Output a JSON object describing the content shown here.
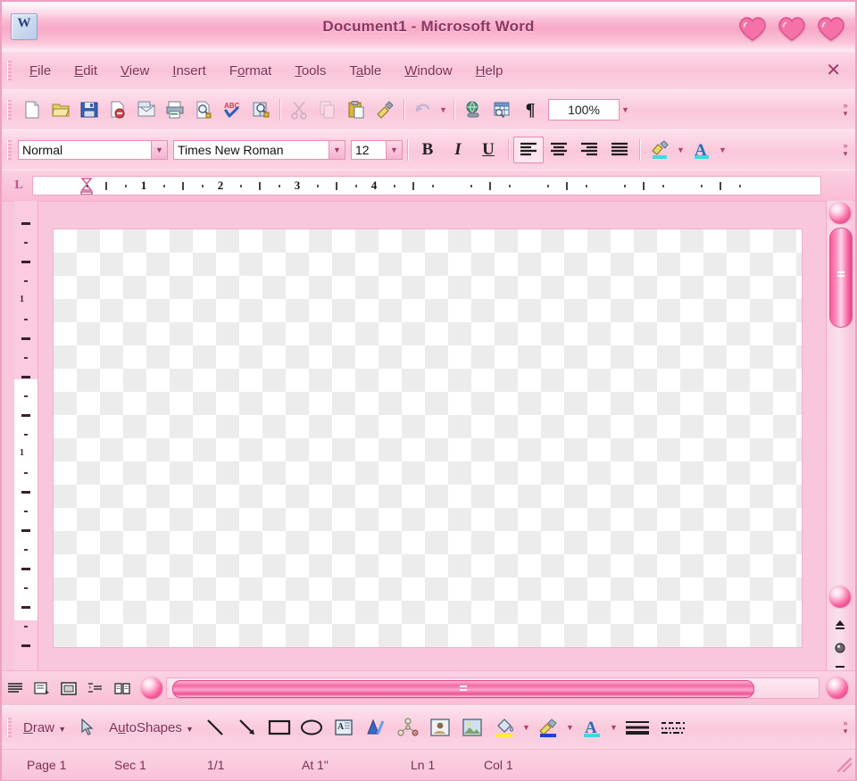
{
  "window": {
    "title": "Document1 - Microsoft Word",
    "app_icon": "word-document-icon",
    "controls": [
      {
        "name": "minimize-button",
        "icon": "heart-icon",
        "label": "Minimize"
      },
      {
        "name": "maximize-button",
        "icon": "heart-icon",
        "label": "Maximize"
      },
      {
        "name": "close-button",
        "icon": "heart-icon",
        "label": "Close"
      }
    ],
    "theme_colors": {
      "accent": "#f569a4",
      "title_text": "#8c3560",
      "chrome_light": "#fde1ec",
      "chrome_mid": "#fac7db",
      "chrome_dark": "#f09ec0",
      "heart": "#f472a8"
    }
  },
  "menubar": {
    "items": [
      {
        "label": "File",
        "accel": "F"
      },
      {
        "label": "Edit",
        "accel": "E"
      },
      {
        "label": "View",
        "accel": "V"
      },
      {
        "label": "Insert",
        "accel": "I"
      },
      {
        "label": "Format",
        "accel": "o"
      },
      {
        "label": "Tools",
        "accel": "T"
      },
      {
        "label": "Table",
        "accel": "a"
      },
      {
        "label": "Window",
        "accel": "W"
      },
      {
        "label": "Help",
        "accel": "H"
      }
    ],
    "close_document_label": "✕"
  },
  "standard_toolbar": {
    "buttons": [
      {
        "name": "new-document-button",
        "icon": "new-page-icon",
        "enabled": true
      },
      {
        "name": "open-button",
        "icon": "open-folder-icon",
        "enabled": true
      },
      {
        "name": "save-button",
        "icon": "floppy-disk-icon",
        "enabled": true
      },
      {
        "name": "permission-button",
        "icon": "document-lock-icon",
        "enabled": true
      },
      {
        "name": "email-button",
        "icon": "envelope-mail-icon",
        "enabled": true
      },
      {
        "name": "print-button",
        "icon": "printer-icon",
        "enabled": true
      },
      {
        "name": "print-preview-button",
        "icon": "magnifier-page-icon",
        "enabled": true
      },
      {
        "name": "spelling-grammar-button",
        "icon": "abc-check-icon",
        "enabled": true
      },
      {
        "name": "research-button",
        "icon": "book-magnifier-icon",
        "enabled": true
      },
      {
        "name": "cut-button",
        "icon": "scissors-icon",
        "enabled": false
      },
      {
        "name": "copy-button",
        "icon": "copy-pages-icon",
        "enabled": false
      },
      {
        "name": "paste-button",
        "icon": "clipboard-paste-icon",
        "enabled": true
      },
      {
        "name": "format-painter-button",
        "icon": "paintbrush-icon",
        "enabled": true
      },
      {
        "name": "undo-button",
        "icon": "undo-arrow-icon",
        "enabled": false
      },
      {
        "name": "insert-hyperlink-button",
        "icon": "globe-link-icon",
        "enabled": true
      },
      {
        "name": "tables-and-borders-button",
        "icon": "table-borders-icon",
        "enabled": true
      },
      {
        "name": "show-formatting-button",
        "icon": "pilcrow-icon",
        "enabled": true,
        "glyph": "¶"
      }
    ],
    "zoom": {
      "value": "100%",
      "dropdown_icon": "chevron-down-icon"
    },
    "overflow_icon": "toolbar-options-icon"
  },
  "formatting_toolbar": {
    "style": {
      "label": "Style",
      "value": "Normal",
      "dropdown_icon": "chevron-down-icon"
    },
    "font": {
      "label": "Font",
      "value": "Times New Roman",
      "dropdown_icon": "chevron-down-icon"
    },
    "size": {
      "label": "Font Size",
      "value": "12",
      "dropdown_icon": "chevron-down-icon"
    },
    "bold": {
      "glyph": "B",
      "active": false
    },
    "italic": {
      "glyph": "I",
      "active": false
    },
    "underline": {
      "glyph": "U",
      "active": false
    },
    "align": [
      {
        "name": "align-left-button",
        "active": true
      },
      {
        "name": "align-center-button",
        "active": false
      },
      {
        "name": "align-right-button",
        "active": false
      },
      {
        "name": "align-justify-button",
        "active": false
      }
    ],
    "highlight": {
      "name": "highlight-color-button",
      "swatch": "#3fd8e0"
    },
    "font_color": {
      "name": "font-color-button",
      "glyph": "A",
      "swatch": "#3fd8e0"
    },
    "overflow_icon": "toolbar-options-icon"
  },
  "ruler": {
    "tab_stop_selector": {
      "name": "tab-stop-selector",
      "glyph": "L"
    },
    "horizontal_numbers": [
      "1",
      "2",
      "3",
      "4"
    ],
    "vertical_numbers": [
      "1",
      "1"
    ],
    "indent_marker_icon": "hourglass-indent-icon"
  },
  "document": {
    "page_background": "transparency-checkerboard",
    "content": ""
  },
  "scrollbars": {
    "vertical": {
      "up_button_icon": "pearl-up-icon",
      "down_button_icon": "pearl-down-icon",
      "thumb_name": "vertical-scroll-thumb",
      "browse_buttons": [
        {
          "name": "previous-page-button",
          "icon": "double-up-arrow-icon",
          "glyph": "⤒"
        },
        {
          "name": "select-browse-object-button",
          "icon": "browse-object-icon",
          "glyph": "●"
        },
        {
          "name": "next-page-button",
          "icon": "double-down-arrow-icon",
          "glyph": "⤓"
        }
      ]
    },
    "horizontal": {
      "left_button_icon": "pearl-left-icon",
      "right_button_icon": "pearl-right-icon",
      "thumb_name": "horizontal-scroll-thumb"
    }
  },
  "view_buttons": [
    {
      "name": "normal-view-button",
      "icon": "normal-view-icon",
      "active": false
    },
    {
      "name": "web-layout-view-button",
      "icon": "web-layout-icon",
      "active": false
    },
    {
      "name": "print-layout-view-button",
      "icon": "print-layout-icon",
      "active": true
    },
    {
      "name": "outline-view-button",
      "icon": "outline-view-icon",
      "active": false
    },
    {
      "name": "reading-layout-view-button",
      "icon": "reading-layout-icon",
      "active": false
    }
  ],
  "drawing_toolbar": {
    "draw_menu": {
      "label": "Draw",
      "accel": "D",
      "dropdown_icon": "chevron-down-icon"
    },
    "select_objects": {
      "name": "select-objects-button",
      "icon": "arrow-cursor-icon"
    },
    "autoshapes_menu": {
      "label": "AutoShapes",
      "accel": "u",
      "dropdown_icon": "chevron-down-icon"
    },
    "buttons": [
      {
        "name": "line-button",
        "icon": "line-icon"
      },
      {
        "name": "arrow-button",
        "icon": "arrow-icon"
      },
      {
        "name": "rectangle-button",
        "icon": "rectangle-icon"
      },
      {
        "name": "oval-button",
        "icon": "oval-icon"
      },
      {
        "name": "text-box-button",
        "icon": "text-box-icon"
      },
      {
        "name": "insert-wordart-button",
        "icon": "wordart-icon"
      },
      {
        "name": "insert-diagram-button",
        "icon": "diagram-organization-chart-icon"
      },
      {
        "name": "insert-clip-art-button",
        "icon": "clip-art-icon"
      },
      {
        "name": "insert-picture-button",
        "icon": "picture-icon"
      }
    ],
    "color_buttons": [
      {
        "name": "fill-color-button",
        "icon": "paint-bucket-icon",
        "swatch": "#ffe93a"
      },
      {
        "name": "line-color-button",
        "icon": "paintbrush-line-icon",
        "swatch": "#1b3fd8"
      },
      {
        "name": "font-color-button",
        "icon": "font-color-a-icon",
        "glyph": "A",
        "swatch": "#3fd8e0"
      }
    ],
    "style_buttons": [
      {
        "name": "line-style-button",
        "icon": "line-style-icon"
      },
      {
        "name": "dash-style-button",
        "icon": "dash-style-icon"
      }
    ],
    "overflow_icon": "toolbar-options-icon"
  },
  "statusbar": {
    "cells": [
      {
        "name": "status-page",
        "text": "Page 1"
      },
      {
        "name": "status-section",
        "text": "Sec 1"
      },
      {
        "name": "status-page-count",
        "text": "1/1"
      },
      {
        "name": "status-at-position",
        "text": "At 1\""
      },
      {
        "name": "status-line",
        "text": "Ln 1"
      },
      {
        "name": "status-column",
        "text": "Col 1"
      }
    ],
    "resize_grip_icon": "resize-grip-icon"
  }
}
